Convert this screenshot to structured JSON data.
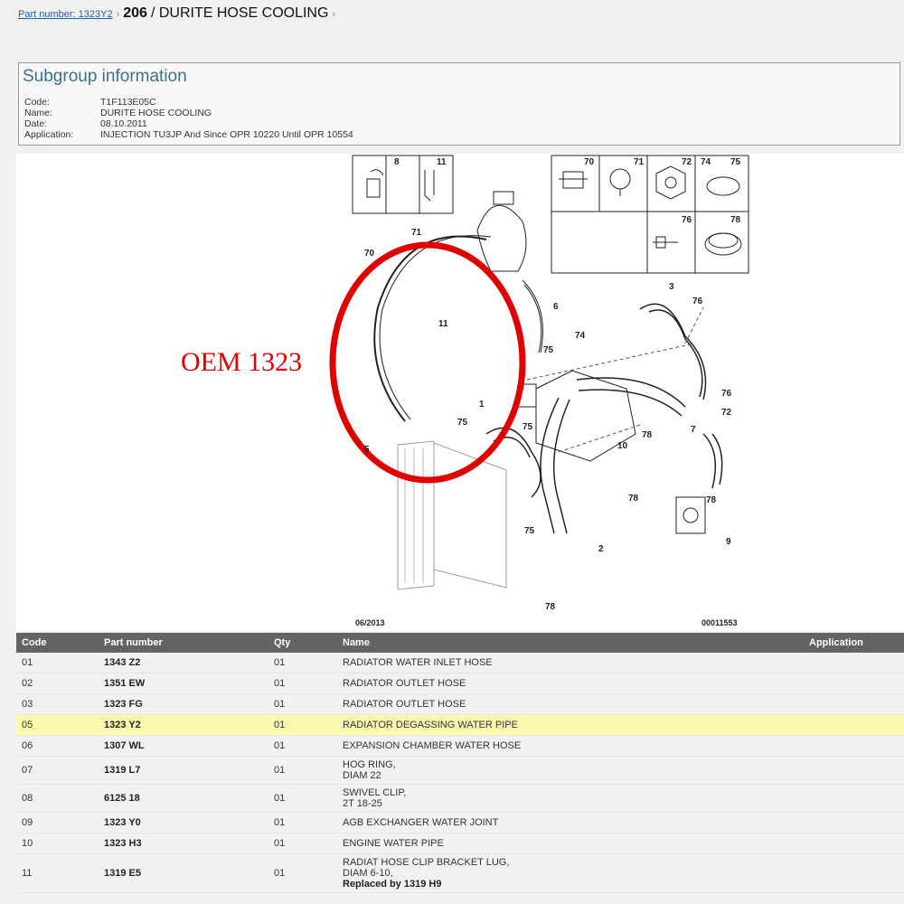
{
  "breadcrumb": {
    "link": "Part number: 1323Y2",
    "model": "206",
    "title": "/ DURITE HOSE COOLING"
  },
  "subgroup": {
    "heading": "Subgroup information",
    "fields": [
      {
        "label": "Code:",
        "value": "T1F113E05C"
      },
      {
        "label": "Name:",
        "value": "DURITE HOSE COOLING"
      },
      {
        "label": "Date:",
        "value": "08.10.2011"
      },
      {
        "label": "Application:",
        "value": "INJECTION TU3JP And Since OPR 10220 Until OPR 10554"
      }
    ]
  },
  "diagram": {
    "overlay_text": "OEM 1323",
    "date_code": "06/2013",
    "ref_code": "00011553",
    "box_labels": [
      "8",
      "11",
      "70",
      "71",
      "72",
      "74",
      "75",
      "76",
      "78"
    ],
    "callouts": [
      "71",
      "70",
      "11",
      "5",
      "6",
      "75",
      "74",
      "3",
      "76",
      "76",
      "72",
      "7",
      "1",
      "75",
      "75",
      "78",
      "10",
      "78",
      "78",
      "9",
      "75",
      "2",
      "78"
    ]
  },
  "table": {
    "headers": {
      "code": "Code",
      "part": "Part number",
      "qty": "Qty",
      "name": "Name",
      "app": "Application"
    },
    "rows": [
      {
        "code": "01",
        "part": "1343 Z2",
        "qty": "01",
        "name": [
          "RADIATOR WATER INLET HOSE"
        ]
      },
      {
        "code": "02",
        "part": "1351 EW",
        "qty": "01",
        "name": [
          "RADIATOR OUTLET HOSE"
        ]
      },
      {
        "code": "03",
        "part": "1323 FG",
        "qty": "01",
        "name": [
          "RADIATOR OUTLET HOSE"
        ]
      },
      {
        "code": "05",
        "part": "1323 Y2",
        "qty": "01",
        "name": [
          "RADIATOR DEGASSING WATER PIPE"
        ]
      },
      {
        "code": "06",
        "part": "1307 WL",
        "qty": "01",
        "name": [
          "EXPANSION CHAMBER WATER HOSE"
        ]
      },
      {
        "code": "07",
        "part": "1319 L7",
        "qty": "01",
        "name": [
          "HOG RING,",
          "DIAM 22"
        ]
      },
      {
        "code": "08",
        "part": "6125 18",
        "qty": "01",
        "name": [
          "SWIVEL CLIP,",
          "2T 18-25"
        ]
      },
      {
        "code": "09",
        "part": "1323 Y0",
        "qty": "01",
        "name": [
          "AGB EXCHANGER WATER JOINT"
        ]
      },
      {
        "code": "10",
        "part": "1323 H3",
        "qty": "01",
        "name": [
          "ENGINE WATER PIPE"
        ]
      },
      {
        "code": "11",
        "part": "1319 E5",
        "qty": "01",
        "name": [
          "RADIAT HOSE CLIP BRACKET LUG,",
          "DIAM 6-10,"
        ],
        "note": "Replaced by 1319 H9"
      }
    ]
  },
  "colors": {
    "highlight": "#fbf8b0",
    "header_bg": "#636363",
    "accent_red": "#e00000",
    "link": "#1f5fa6"
  }
}
